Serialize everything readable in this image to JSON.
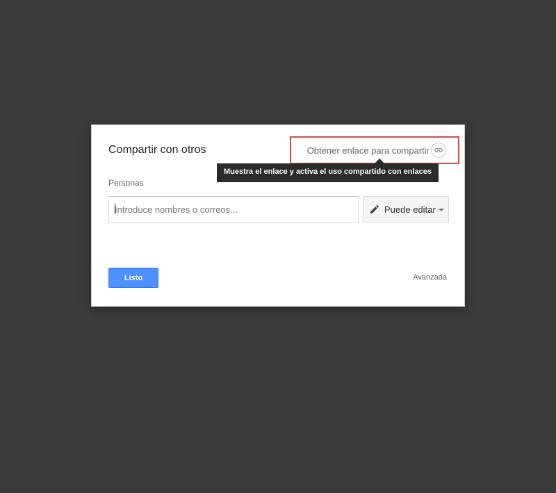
{
  "dialog": {
    "title": "Compartir con otros",
    "get_link_label": "Obtener enlace para compartir",
    "tooltip": "Muestra el enlace y activa el uso compartido con enlaces",
    "people_label": "Personas",
    "people_input": {
      "value": "",
      "placeholder": "Introduce nombres o correos..."
    },
    "permission": {
      "selected": "Puede editar",
      "icon": "pencil-icon"
    },
    "done_label": "Listo",
    "advanced_label": "Avanzada"
  },
  "colors": {
    "backdrop": "#3b3b3b",
    "primary_button": "#4d90fe",
    "highlight": "#d9493d",
    "tooltip_bg": "#2b2b2b"
  }
}
